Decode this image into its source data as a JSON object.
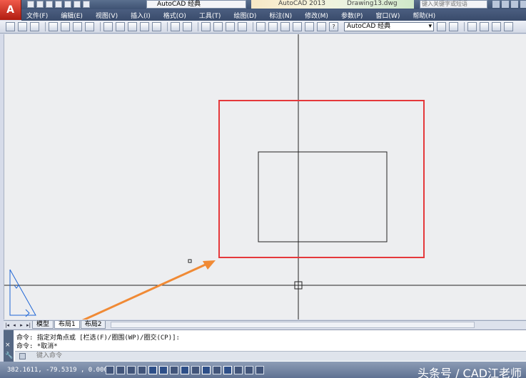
{
  "titlebar": {
    "logo": "A",
    "workspace": "AutoCAD 经典",
    "product": "AutoCAD 2013",
    "document": "Drawing13.dwg",
    "search_placeholder": "键入关键字或短语"
  },
  "menu": [
    "文件(F)",
    "编辑(E)",
    "视图(V)",
    "插入(I)",
    "格式(O)",
    "工具(T)",
    "绘图(D)",
    "标注(N)",
    "修改(M)",
    "参数(P)",
    "窗口(W)",
    "帮助(H)"
  ],
  "toolbar": {
    "workspace_select": "AutoCAD 经典",
    "help_label": "?"
  },
  "tabs": {
    "nav": [
      "|◂",
      "◂",
      "▸",
      "▸|"
    ],
    "items": [
      "模型",
      "布局1",
      "布局2"
    ],
    "active": "布局1"
  },
  "command": {
    "line1": "命令: 指定对角点或 [栏选(F)/圈围(WP)/圈交(CP)]:",
    "line2": "命令: *取消*",
    "input_placeholder": "键入命令",
    "close_icon": "×",
    "wrench_icon": "🔧"
  },
  "status": {
    "coords": "382.1611, -79.5319 , 0.0000",
    "watermark": "头条号 / CAD江老师"
  },
  "colors": {
    "selection_rect": "#e5383b",
    "arrow": "#f08a35",
    "ucs_icon": "#1f66d6"
  }
}
